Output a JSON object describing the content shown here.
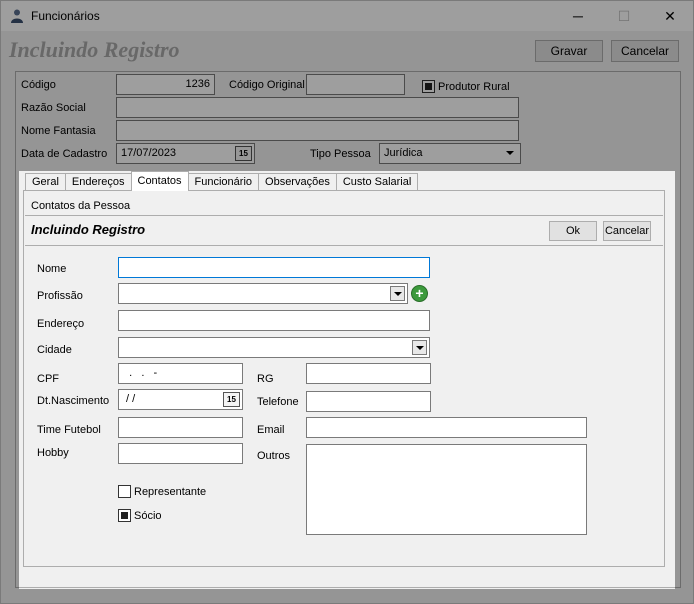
{
  "window": {
    "title": "Funcionários",
    "minimize_glyph": "─",
    "maximize_glyph": "☐",
    "close_glyph": "✕"
  },
  "header": {
    "title": "Incluindo Registro",
    "save_label": "Gravar",
    "cancel_label": "Cancelar"
  },
  "form": {
    "codigo_label": "Código",
    "codigo_value": "1236",
    "codigo_original_label": "Código Original",
    "codigo_original_value": "",
    "produtor_rural_label": "Produtor Rural",
    "produtor_rural_checked": true,
    "razao_social_label": "Razão Social",
    "nome_fantasia_label": "Nome Fantasia",
    "data_cadastro_label": "Data de Cadastro",
    "data_cadastro_value": "17/07/2023",
    "tipo_pessoa_label": "Tipo Pessoa",
    "tipo_pessoa_value": "Jurídica"
  },
  "tabs": [
    "Geral",
    "Endereços",
    "Contatos",
    "Funcionário",
    "Observações",
    "Custo Salarial"
  ],
  "active_tab": "Contatos",
  "contacts": {
    "section_title": "Contatos da Pessoa",
    "sub_title": "Incluindo Registro",
    "ok_label": "Ok",
    "cancel_label": "Cancelar",
    "nome_label": "Nome",
    "profissao_label": "Profissão",
    "endereco_label": "Endereço",
    "cidade_label": "Cidade",
    "cpf_label": "CPF",
    "cpf_mask": "  .   .   -",
    "rg_label": "RG",
    "dt_nascimento_label": "Dt.Nascimento",
    "dt_nascimento_mask": " / /",
    "telefone_label": "Telefone",
    "time_futebol_label": "Time Futebol",
    "email_label": "Email",
    "hobby_label": "Hobby",
    "outros_label": "Outros",
    "representante_label": "Representante",
    "representante_checked": false,
    "socio_label": "Sócio",
    "socio_checked": true
  },
  "icons": {
    "app_icon": "user-icon",
    "calendar_glyph": "15",
    "add_glyph": "+"
  },
  "colors": {
    "title_dim": "#a8a8a8",
    "focus_border": "#0078d7",
    "add_green": "#3c9a3c"
  }
}
